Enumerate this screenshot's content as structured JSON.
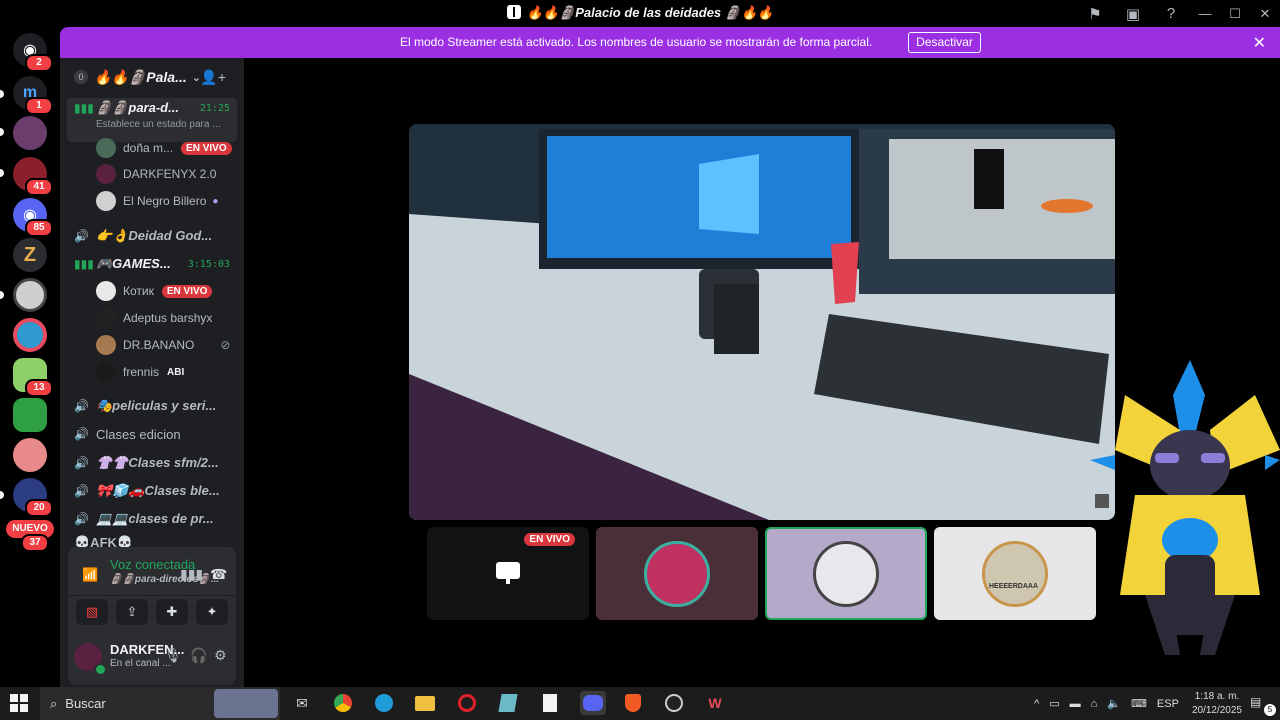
{
  "window": {
    "title": "🔥🔥🗿Palacio de las deidades 🗿🔥🔥",
    "icons": [
      "inbox-flag-icon",
      "screen-share-alert-icon",
      "help-icon"
    ],
    "controls": [
      "—",
      "☐",
      "✕"
    ]
  },
  "rail": {
    "servers": [
      {
        "name": "discord-home",
        "badge": "2",
        "color": "#1e1f22",
        "glyph": "D"
      },
      {
        "name": "server-m",
        "badge": "1",
        "color": "#1e1f22",
        "glyph": "m"
      },
      {
        "name": "server-purple",
        "badge": "",
        "color": "#6a3d6d",
        "glyph": ""
      },
      {
        "name": "server-red",
        "badge": "41",
        "color": "#8c1f2c",
        "glyph": ""
      },
      {
        "name": "server-discord",
        "badge": "85",
        "color": "#5865f2",
        "glyph": "D"
      },
      {
        "name": "server-z",
        "badge": "",
        "color": "#2b2d31",
        "glyph": "Z"
      },
      {
        "name": "server-bw",
        "badge": "",
        "color": "#cfcfcf",
        "glyph": ""
      },
      {
        "name": "server-ring",
        "badge": "",
        "color": "#2e9ad0",
        "glyph": ""
      },
      {
        "name": "server-anime",
        "badge": "13",
        "color": "#8fcf6a",
        "glyph": ""
      },
      {
        "name": "server-yellow",
        "badge": "",
        "color": "#2ea043",
        "glyph": ""
      },
      {
        "name": "server-pink",
        "badge": "",
        "color": "#e88a8a",
        "glyph": ""
      },
      {
        "name": "server-blue",
        "badge": "20",
        "color": "#2c3c80",
        "glyph": ""
      }
    ],
    "nuevo_label": "NUEVO",
    "nuevo_badge": "37"
  },
  "banner": {
    "message": "El modo Streamer está activado. Los nombres de usuario se mostrarán de forma parcial.",
    "button": "Desactivar"
  },
  "guild": {
    "count": "0",
    "name": "🔥🔥🗿Pala..."
  },
  "channels": {
    "c1": {
      "name": "🗿🗿para-d...",
      "time": "21:25",
      "status": "Establece un estado para ..."
    },
    "c1_users": [
      {
        "name": "doña m...",
        "live": "EN VIVO"
      },
      {
        "name": "DARKFENYX 2.0",
        "live": ""
      },
      {
        "name": "El Negro Billero",
        "live": ""
      }
    ],
    "c2": "👉👌Deidad God...",
    "c3": {
      "name": "🎮GAMES...",
      "time": "3:15:03"
    },
    "c3_users": [
      {
        "name": "Котик",
        "live": "EN VIVO"
      },
      {
        "name": "Adeptus barshyx",
        "live": ""
      },
      {
        "name": "DR.BANANO",
        "live": ""
      },
      {
        "name": "frennis",
        "live": "ABI"
      }
    ],
    "c4": "🎭peliculas y seri...",
    "c5": "Clases edicion",
    "c6": "👚👚Clases sfm/2...",
    "c7": "🎀🧊🚗Clases ble...",
    "c8": "💻💻clases de pr...",
    "c9": "💀AFK💀"
  },
  "voice": {
    "title": "Voz conectada",
    "channel": "🗿🗿para-directos🗿..."
  },
  "me": {
    "name": "DARKFEN...",
    "status": "En el canal ..."
  },
  "stage": {
    "live_label": "EN VIVO",
    "tile4_caption": "HEEEERDAAA"
  },
  "taskbar": {
    "search": "Buscar",
    "lang": "ESP",
    "time": "1:18 a. m.",
    "date": "20/12/2025",
    "notifications": "5"
  }
}
